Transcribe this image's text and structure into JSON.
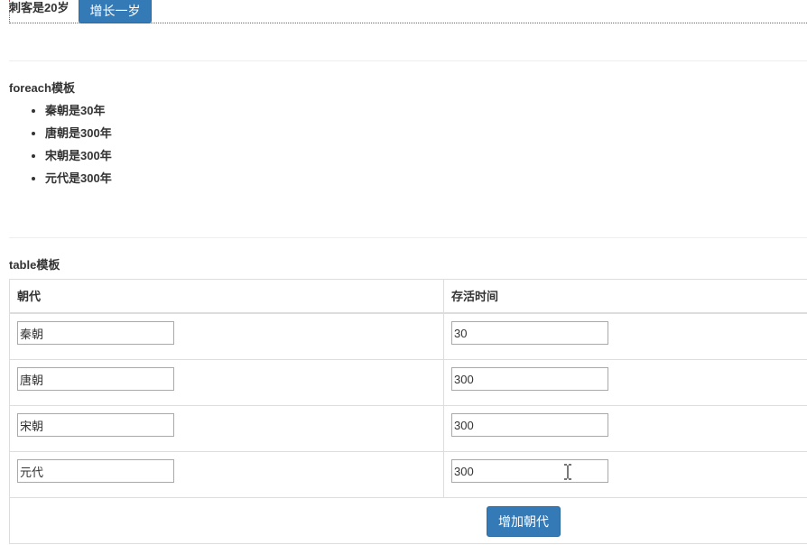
{
  "top": {
    "age_text": "刺客是20岁",
    "grow_button_label": "增长一岁"
  },
  "foreach_section": {
    "title": "foreach模板",
    "items": [
      {
        "label": "秦朝是30年"
      },
      {
        "label": "唐朝是300年"
      },
      {
        "label": "宋朝是300年"
      },
      {
        "label": "元代是300年"
      }
    ]
  },
  "table_section": {
    "title": "table模板",
    "headers": [
      "朝代",
      "存活时间"
    ],
    "rows": [
      {
        "name": "秦朝",
        "years": "30"
      },
      {
        "name": "唐朝",
        "years": "300"
      },
      {
        "name": "宋朝",
        "years": "300"
      },
      {
        "name": "元代",
        "years": "300"
      }
    ],
    "add_button_label": "增加朝代"
  },
  "colors": {
    "primary_button": "#337ab7",
    "border": "#dddddd"
  },
  "icons": {
    "cursor": "text-cursor-icon"
  }
}
